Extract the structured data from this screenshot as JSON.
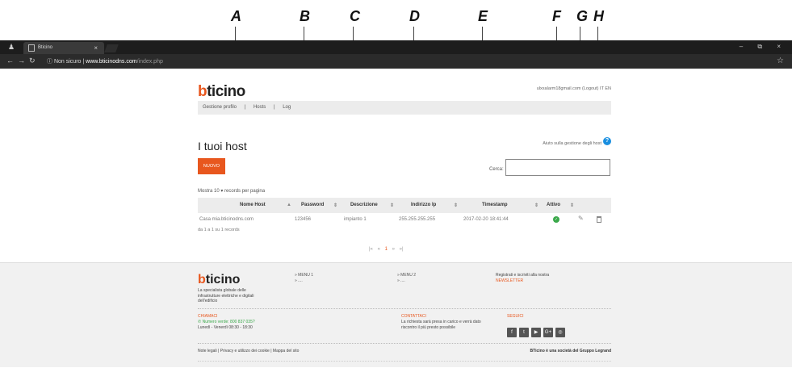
{
  "annotations": [
    "A",
    "B",
    "C",
    "D",
    "E",
    "F",
    "G",
    "H"
  ],
  "browser": {
    "tab_title": "Bticino",
    "tab_close": "×",
    "url_secure": "Non sicuro",
    "url_host": "www.bticinodns.com",
    "url_path": "/index.php",
    "win_buttons": "– ⧉ ×"
  },
  "header": {
    "logo_b": "b",
    "logo_rest": "ticino",
    "user": "ulxxalarm18gmail.com (Logout)   IT  EN",
    "menu": [
      "Gestione profilo",
      "|",
      "Hosts",
      "|",
      "Log"
    ]
  },
  "main": {
    "title": "I tuoi host",
    "help_link": "Aiuto sulla gestione degli host",
    "help_icon": "?",
    "new_button": "NUOVO",
    "search_label": "Cerca:",
    "show_entries": "Mostra  10   ▾  records per pagina",
    "columns": {
      "name": "Nome Host",
      "password": "Password",
      "description": "Descrizione",
      "ip": "Indirizzo Ip",
      "timestamp": "Timestamp",
      "active": "Attivo"
    },
    "sort_asc": "▲",
    "sort_both": "⇕",
    "row": {
      "name": "Casa mia.bticinodns.com",
      "password": "123456",
      "description": "impianto 1",
      "ip": "255.255.255.255",
      "timestamp": "2017-02-20 18:41:44"
    },
    "info": "da 1 a 1 su 1 records",
    "pager": [
      "|«",
      "«",
      "1",
      "»",
      "»|"
    ]
  },
  "footer": {
    "logo_b": "b",
    "logo_rest": "ticino",
    "tagline": "La specialista globale delle infrastrutture elettriche e digitali dell'edificio",
    "menu1": "» MENU 1",
    "menu1_item": "» ....",
    "menu2": "» MENU 2",
    "menu2_item": "» ....",
    "newsletter_text": "Registrati e iscriviti alla nostra",
    "newsletter": "NEWSLETTER",
    "call_title": "CHIAMACI",
    "green_number": "Numero verde: 800 837 035?",
    "hours": "Lunedì - Venerdì 08:30 - 18:30",
    "contact_title": "CONTATTACI",
    "contact_text": "La richiesta sarà presa in carico e verrà dato riscontro il più presto possibile",
    "follow_title": "SEGUICI",
    "social": [
      "f",
      "t",
      "▶",
      "G+",
      "◎"
    ],
    "legal_links": "Note legali  |  Privacy e utilizzo dei cookie  |  Mappa del sito",
    "legrand": "BTicino è una società del Gruppo Legrand"
  }
}
